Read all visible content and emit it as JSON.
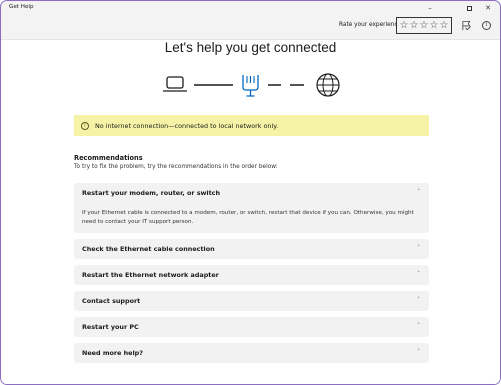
{
  "app": {
    "title": "Get Help"
  },
  "window_controls": {
    "minimize": "–",
    "maximize": "",
    "close": "✕"
  },
  "rating": {
    "label": "Rate your experience",
    "stars": [
      "☆",
      "☆",
      "☆",
      "☆",
      "☆"
    ]
  },
  "icons": {
    "feedback": "feedback-flag-icon",
    "info": "info-icon",
    "laptop": "laptop-icon",
    "ethernet": "ethernet-port-icon",
    "globe": "globe-icon"
  },
  "colors": {
    "accent": "#0067c0",
    "warning_bg": "#f7f3a6",
    "window_border": "#8a6fc0"
  },
  "main": {
    "heading": "Let's help you get connected",
    "warning": {
      "icon": "i",
      "text": "No internet connection—connected to local network only."
    },
    "recommendations": {
      "title": "Recommendations",
      "subtitle": "To try to fix the problem, try the recommendations in the order below:",
      "items": [
        {
          "label": "Restart your modem, router, or switch",
          "expanded": true,
          "chevron": "˄",
          "body": "If your Ethernet cable is connected to a modem, router, or switch, restart that device if you can. Otherwise, you might need to contact your IT support person."
        },
        {
          "label": "Check the Ethernet cable connection",
          "chevron": "˅"
        },
        {
          "label": "Restart the Ethernet network adapter",
          "chevron": "˅"
        },
        {
          "label": "Contact support",
          "chevron": "˅"
        },
        {
          "label": "Restart your PC",
          "chevron": "˅"
        },
        {
          "label": "Need more help?",
          "chevron": "˅"
        }
      ]
    }
  }
}
